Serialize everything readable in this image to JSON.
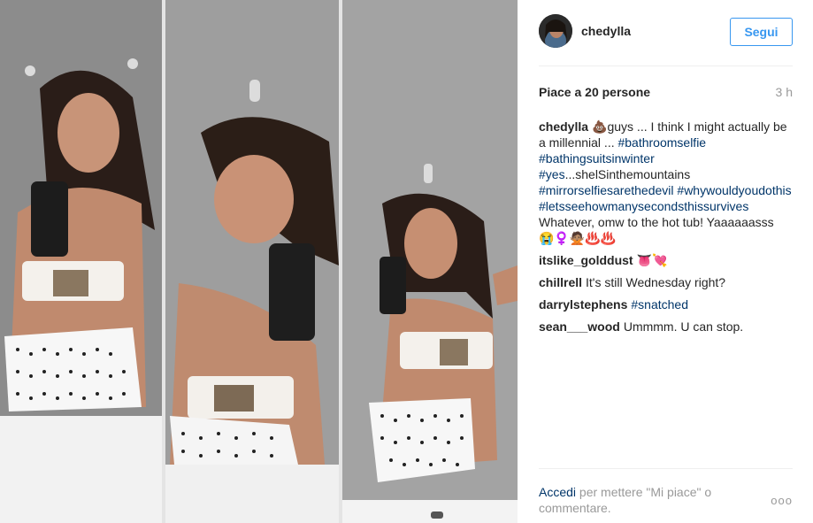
{
  "post": {
    "username": "chedylla",
    "follow_label": "Segui",
    "likes": "Piace a 20 persone",
    "time": "3 h"
  },
  "caption": {
    "author": "chedylla",
    "part1": "💩guys ... I think I might actually be a millennial ... ",
    "tags": [
      "#bathroomselfie",
      "#bathingsuitsinwinter",
      "#yes",
      "#mirrorselfiesarethedevil",
      "#whywouldyoudothis",
      "#letsseehowmanysecondsthissurvives"
    ],
    "after_yes": "...shelSinthemountains",
    "part_end": "Whatever, omw to the hot tub! Yaaaaaasss 😭♀️🙅🏽♨️♨️"
  },
  "comments": [
    {
      "author": "itslike_golddust",
      "text": "👅💘"
    },
    {
      "author": "chillrell",
      "text": "It's still Wednesday right?"
    },
    {
      "author": "darrylstephens",
      "text": "#snatched"
    },
    {
      "author": "sean___wood",
      "text": "Ummmm. U can stop."
    }
  ],
  "footer": {
    "login_link": "Accedi",
    "login_text": " per mettere \"Mi piace\" o commentare.",
    "more_label": "ooo"
  }
}
